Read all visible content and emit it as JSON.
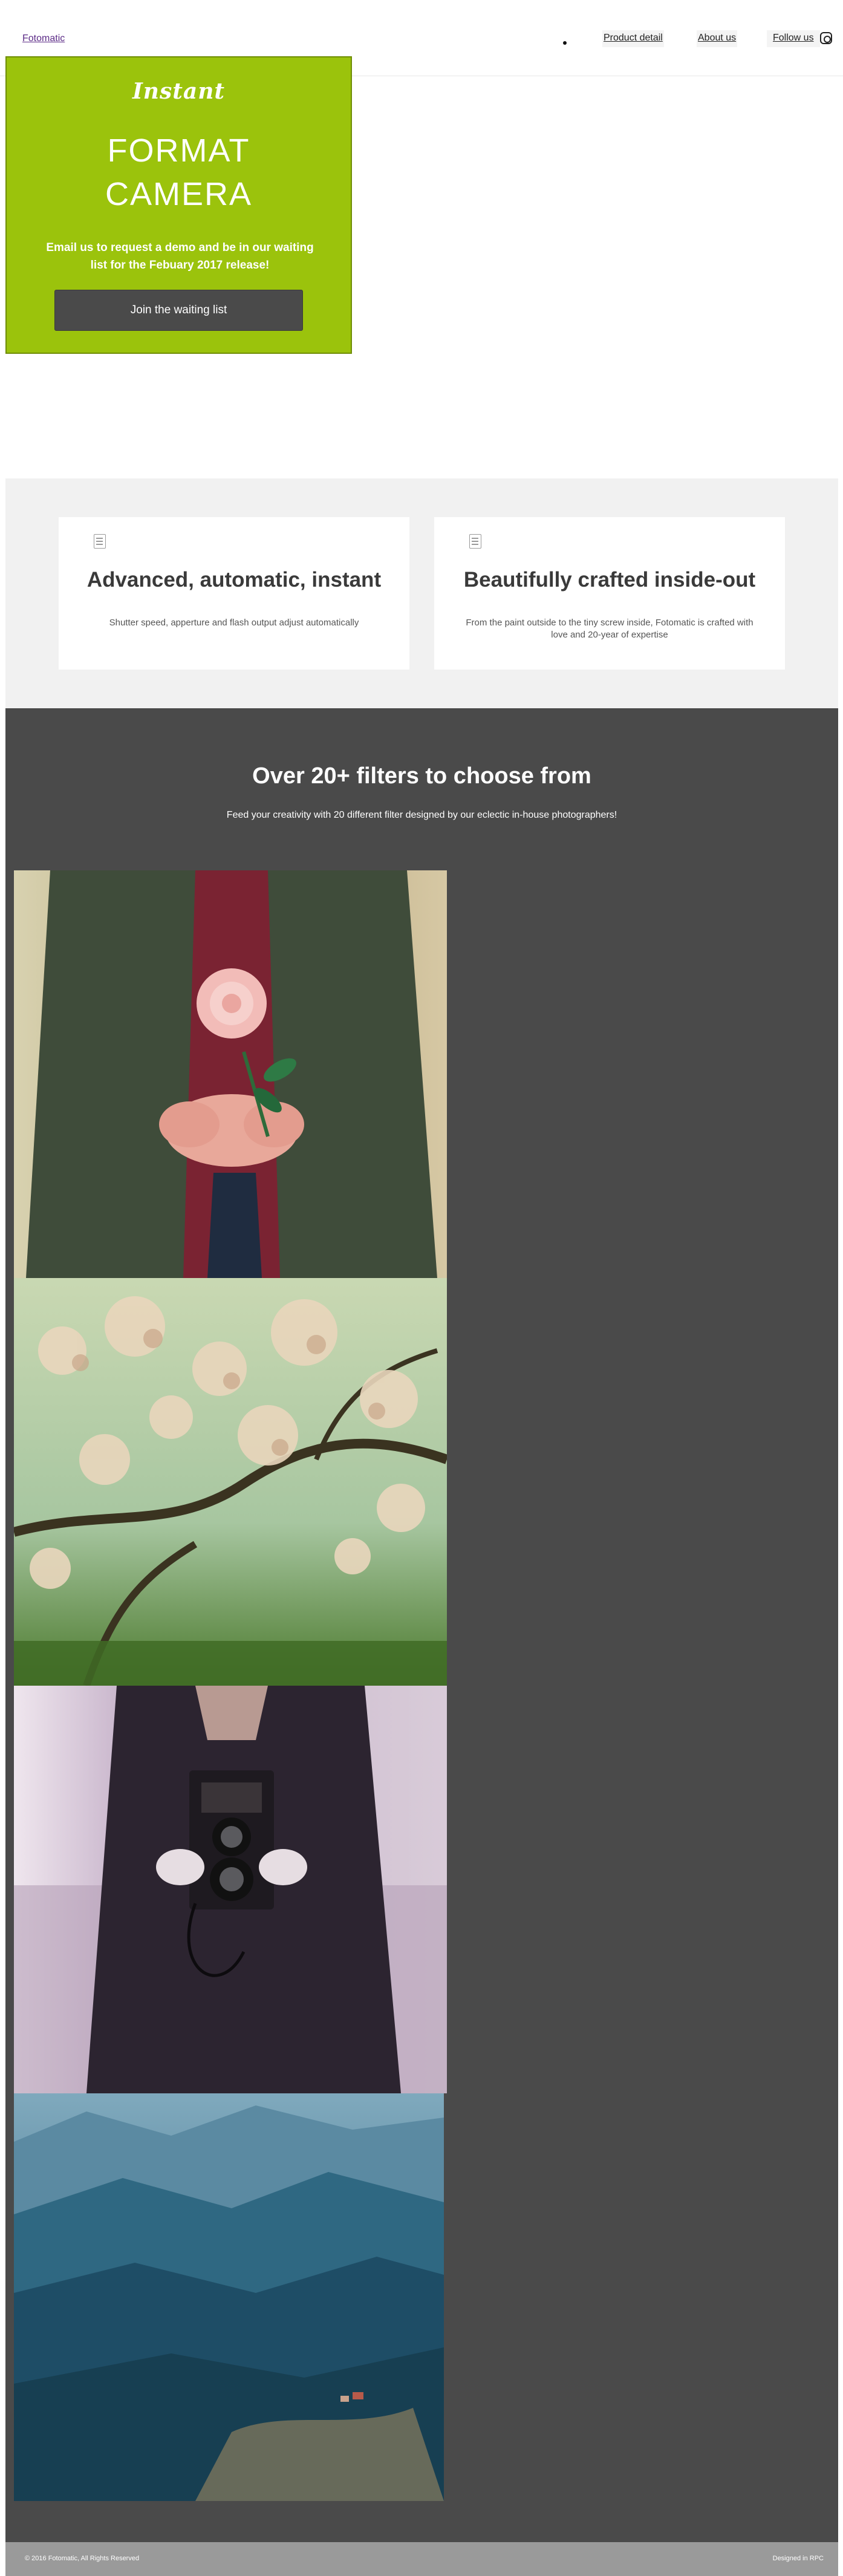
{
  "header": {
    "brand": "Fotomatic",
    "nav": [
      {
        "label": "Product detail",
        "glyph": "⌖"
      },
      {
        "label": "About us",
        "glyph": "⌖"
      },
      {
        "label": "Follow us"
      }
    ],
    "icons": [
      "dot-icon",
      "instagram-icon"
    ]
  },
  "hero": {
    "logo": "Instant",
    "title_line1": "FORMAT",
    "title_line2": "CAMERA",
    "text_before": "Email us to request a demo and be in our waiting list for the ",
    "text_bold": "Febuary 2017",
    "text_after": " release!",
    "button": "Join the waiting list",
    "colors": {
      "background": "#9bc30c",
      "button": "#4a4a4a"
    }
  },
  "features": [
    {
      "icon": "document-icon",
      "title": "Advanced, automatic, instant",
      "text": "Shutter speed, apperture and flash output adjust automatically"
    },
    {
      "icon": "document-icon",
      "title": "Beautifully crafted inside-out",
      "text": "From the paint outside to the tiny screw inside, Fotomatic is crafted with love and 20-year of expertise"
    }
  ],
  "filters": {
    "title": "Over 20+ filters to choose from",
    "subtitle": "Feed your creativity with 20 different filter designed by our eclectic in-house photographers!",
    "photos": [
      "flower-in-hands-photo",
      "blossom-branches-photo",
      "vintage-camera-photo",
      "mountain-valley-photo"
    ]
  },
  "footer": {
    "left": "© 2016 Fotomatic, All Rights Reserved",
    "right": "Designed in RPC"
  }
}
